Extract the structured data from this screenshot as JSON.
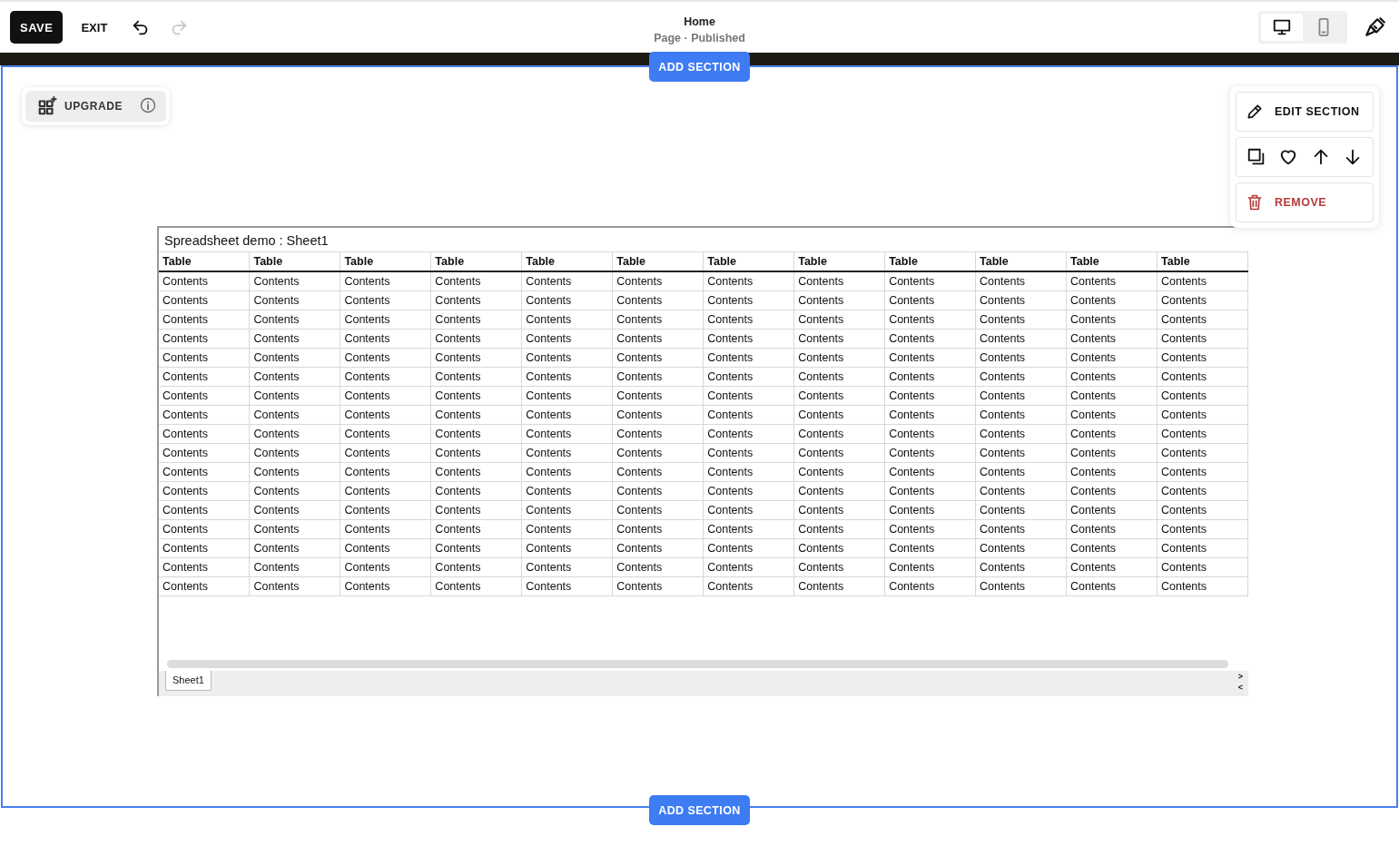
{
  "top_bar": {
    "save": "SAVE",
    "exit": "EXIT",
    "undo": {
      "disabled": false
    },
    "redo": {
      "disabled": true
    },
    "page_title": "Home",
    "page_status": "Page · Published",
    "device_modes": [
      {
        "kind": "desktop",
        "selected": true
      },
      {
        "kind": "mobile",
        "selected": false
      }
    ]
  },
  "add_section_buttons": [
    "ADD SECTION",
    "ADD SECTION"
  ],
  "upgrade_button": "UPGRADE",
  "section_toolbar": {
    "edit": "EDIT SECTION",
    "remove": "REMOVE"
  },
  "spreadsheet": {
    "title": "Spreadsheet demo : Sheet1",
    "columns": [
      "Table",
      "Table",
      "Table",
      "Table",
      "Table",
      "Table",
      "Table",
      "Table",
      "Table",
      "Table",
      "Table",
      "Table"
    ],
    "rows": [
      [
        "Contents",
        "Contents",
        "Contents",
        "Contents",
        "Contents",
        "Contents",
        "Contents",
        "Contents",
        "Contents",
        "Contents",
        "Contents",
        "Contents"
      ],
      [
        "Contents",
        "Contents",
        "Contents",
        "Contents",
        "Contents",
        "Contents",
        "Contents",
        "Contents",
        "Contents",
        "Contents",
        "Contents",
        "Contents"
      ],
      [
        "Contents",
        "Contents",
        "Contents",
        "Contents",
        "Contents",
        "Contents",
        "Contents",
        "Contents",
        "Contents",
        "Contents",
        "Contents",
        "Contents"
      ],
      [
        "Contents",
        "Contents",
        "Contents",
        "Contents",
        "Contents",
        "Contents",
        "Contents",
        "Contents",
        "Contents",
        "Contents",
        "Contents",
        "Contents"
      ],
      [
        "Contents",
        "Contents",
        "Contents",
        "Contents",
        "Contents",
        "Contents",
        "Contents",
        "Contents",
        "Contents",
        "Contents",
        "Contents",
        "Contents"
      ],
      [
        "Contents",
        "Contents",
        "Contents",
        "Contents",
        "Contents",
        "Contents",
        "Contents",
        "Contents",
        "Contents",
        "Contents",
        "Contents",
        "Contents"
      ],
      [
        "Contents",
        "Contents",
        "Contents",
        "Contents",
        "Contents",
        "Contents",
        "Contents",
        "Contents",
        "Contents",
        "Contents",
        "Contents",
        "Contents"
      ],
      [
        "Contents",
        "Contents",
        "Contents",
        "Contents",
        "Contents",
        "Contents",
        "Contents",
        "Contents",
        "Contents",
        "Contents",
        "Contents",
        "Contents"
      ],
      [
        "Contents",
        "Contents",
        "Contents",
        "Contents",
        "Contents",
        "Contents",
        "Contents",
        "Contents",
        "Contents",
        "Contents",
        "Contents",
        "Contents"
      ],
      [
        "Contents",
        "Contents",
        "Contents",
        "Contents",
        "Contents",
        "Contents",
        "Contents",
        "Contents",
        "Contents",
        "Contents",
        "Contents",
        "Contents"
      ],
      [
        "Contents",
        "Contents",
        "Contents",
        "Contents",
        "Contents",
        "Contents",
        "Contents",
        "Contents",
        "Contents",
        "Contents",
        "Contents",
        "Contents"
      ],
      [
        "Contents",
        "Contents",
        "Contents",
        "Contents",
        "Contents",
        "Contents",
        "Contents",
        "Contents",
        "Contents",
        "Contents",
        "Contents",
        "Contents"
      ],
      [
        "Contents",
        "Contents",
        "Contents",
        "Contents",
        "Contents",
        "Contents",
        "Contents",
        "Contents",
        "Contents",
        "Contents",
        "Contents",
        "Contents"
      ],
      [
        "Contents",
        "Contents",
        "Contents",
        "Contents",
        "Contents",
        "Contents",
        "Contents",
        "Contents",
        "Contents",
        "Contents",
        "Contents",
        "Contents"
      ],
      [
        "Contents",
        "Contents",
        "Contents",
        "Contents",
        "Contents",
        "Contents",
        "Contents",
        "Contents",
        "Contents",
        "Contents",
        "Contents",
        "Contents"
      ],
      [
        "Contents",
        "Contents",
        "Contents",
        "Contents",
        "Contents",
        "Contents",
        "Contents",
        "Contents",
        "Contents",
        "Contents",
        "Contents",
        "Contents"
      ],
      [
        "Contents",
        "Contents",
        "Contents",
        "Contents",
        "Contents",
        "Contents",
        "Contents",
        "Contents",
        "Contents",
        "Contents",
        "Contents",
        "Contents"
      ]
    ],
    "sheet_tabs": [
      {
        "label": "Sheet1",
        "selected": true
      }
    ],
    "nav": [
      ">",
      "<"
    ]
  }
}
